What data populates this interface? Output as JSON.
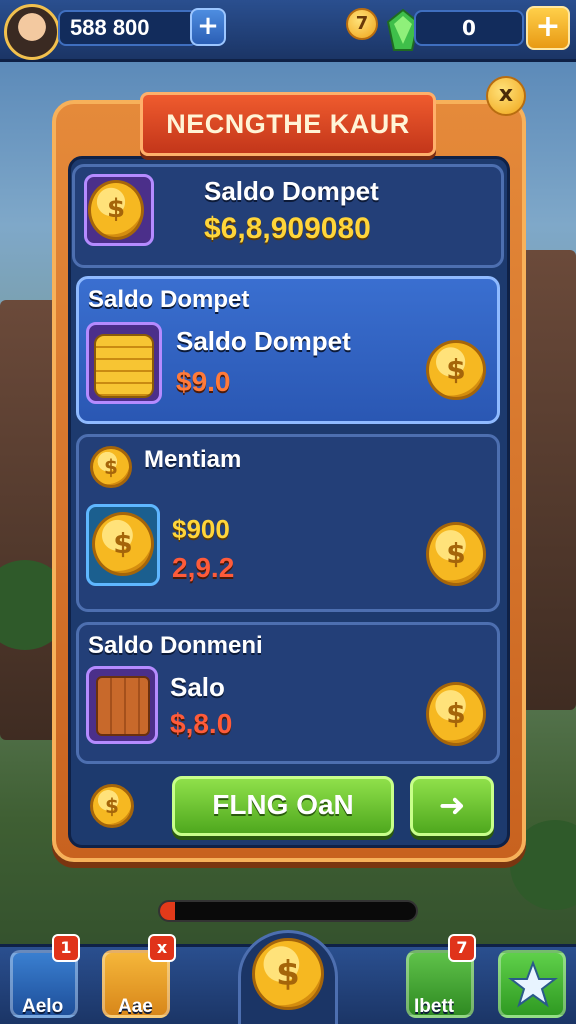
{
  "header": {
    "money": "588 800",
    "plus": "+",
    "coin_badge_count": "7",
    "gem_count": "0",
    "gold_plus": "+"
  },
  "dialog": {
    "title": "NECNGTHE KAUR",
    "close": "x"
  },
  "cards": {
    "balance": {
      "label": "Saldo Dompet",
      "amount": "$6,8,909080"
    },
    "wallet": {
      "header": "Saldo Dompet",
      "label": "Saldo Dompet",
      "amount": "$9.0"
    },
    "mentiam": {
      "header": "Mentiam",
      "amount_top": "$900",
      "amount_bottom": "2,9.2"
    },
    "saldo_domiheni": {
      "header": "Saldo Donmeni",
      "label": "Salo",
      "amount": "$,8.0"
    }
  },
  "actions": {
    "main_button": "FLNG OaN",
    "arrow": "➜"
  },
  "progress": {
    "value": 0.06
  },
  "bottom_nav": {
    "items": [
      {
        "label": "Aelo",
        "badge": "1"
      },
      {
        "label": "Aae",
        "badge": "x"
      },
      {
        "label": "",
        "badge": ""
      },
      {
        "label": "Ibett",
        "badge": "7"
      },
      {
        "label": "",
        "badge": ""
      }
    ]
  },
  "colors": {
    "panel_orange": "#e58a3a",
    "panel_navy": "#1d3a6e",
    "ribbon_red": "#ef5b2e",
    "button_green": "#6fc22e",
    "coin_gold": "#f6b821"
  },
  "icons": [
    "avatar",
    "plus-icon",
    "coin-icon",
    "gem-icon",
    "close-icon",
    "arrow-right-icon",
    "star-icon",
    "gift-icon",
    "crate-icon",
    "book-icon"
  ]
}
